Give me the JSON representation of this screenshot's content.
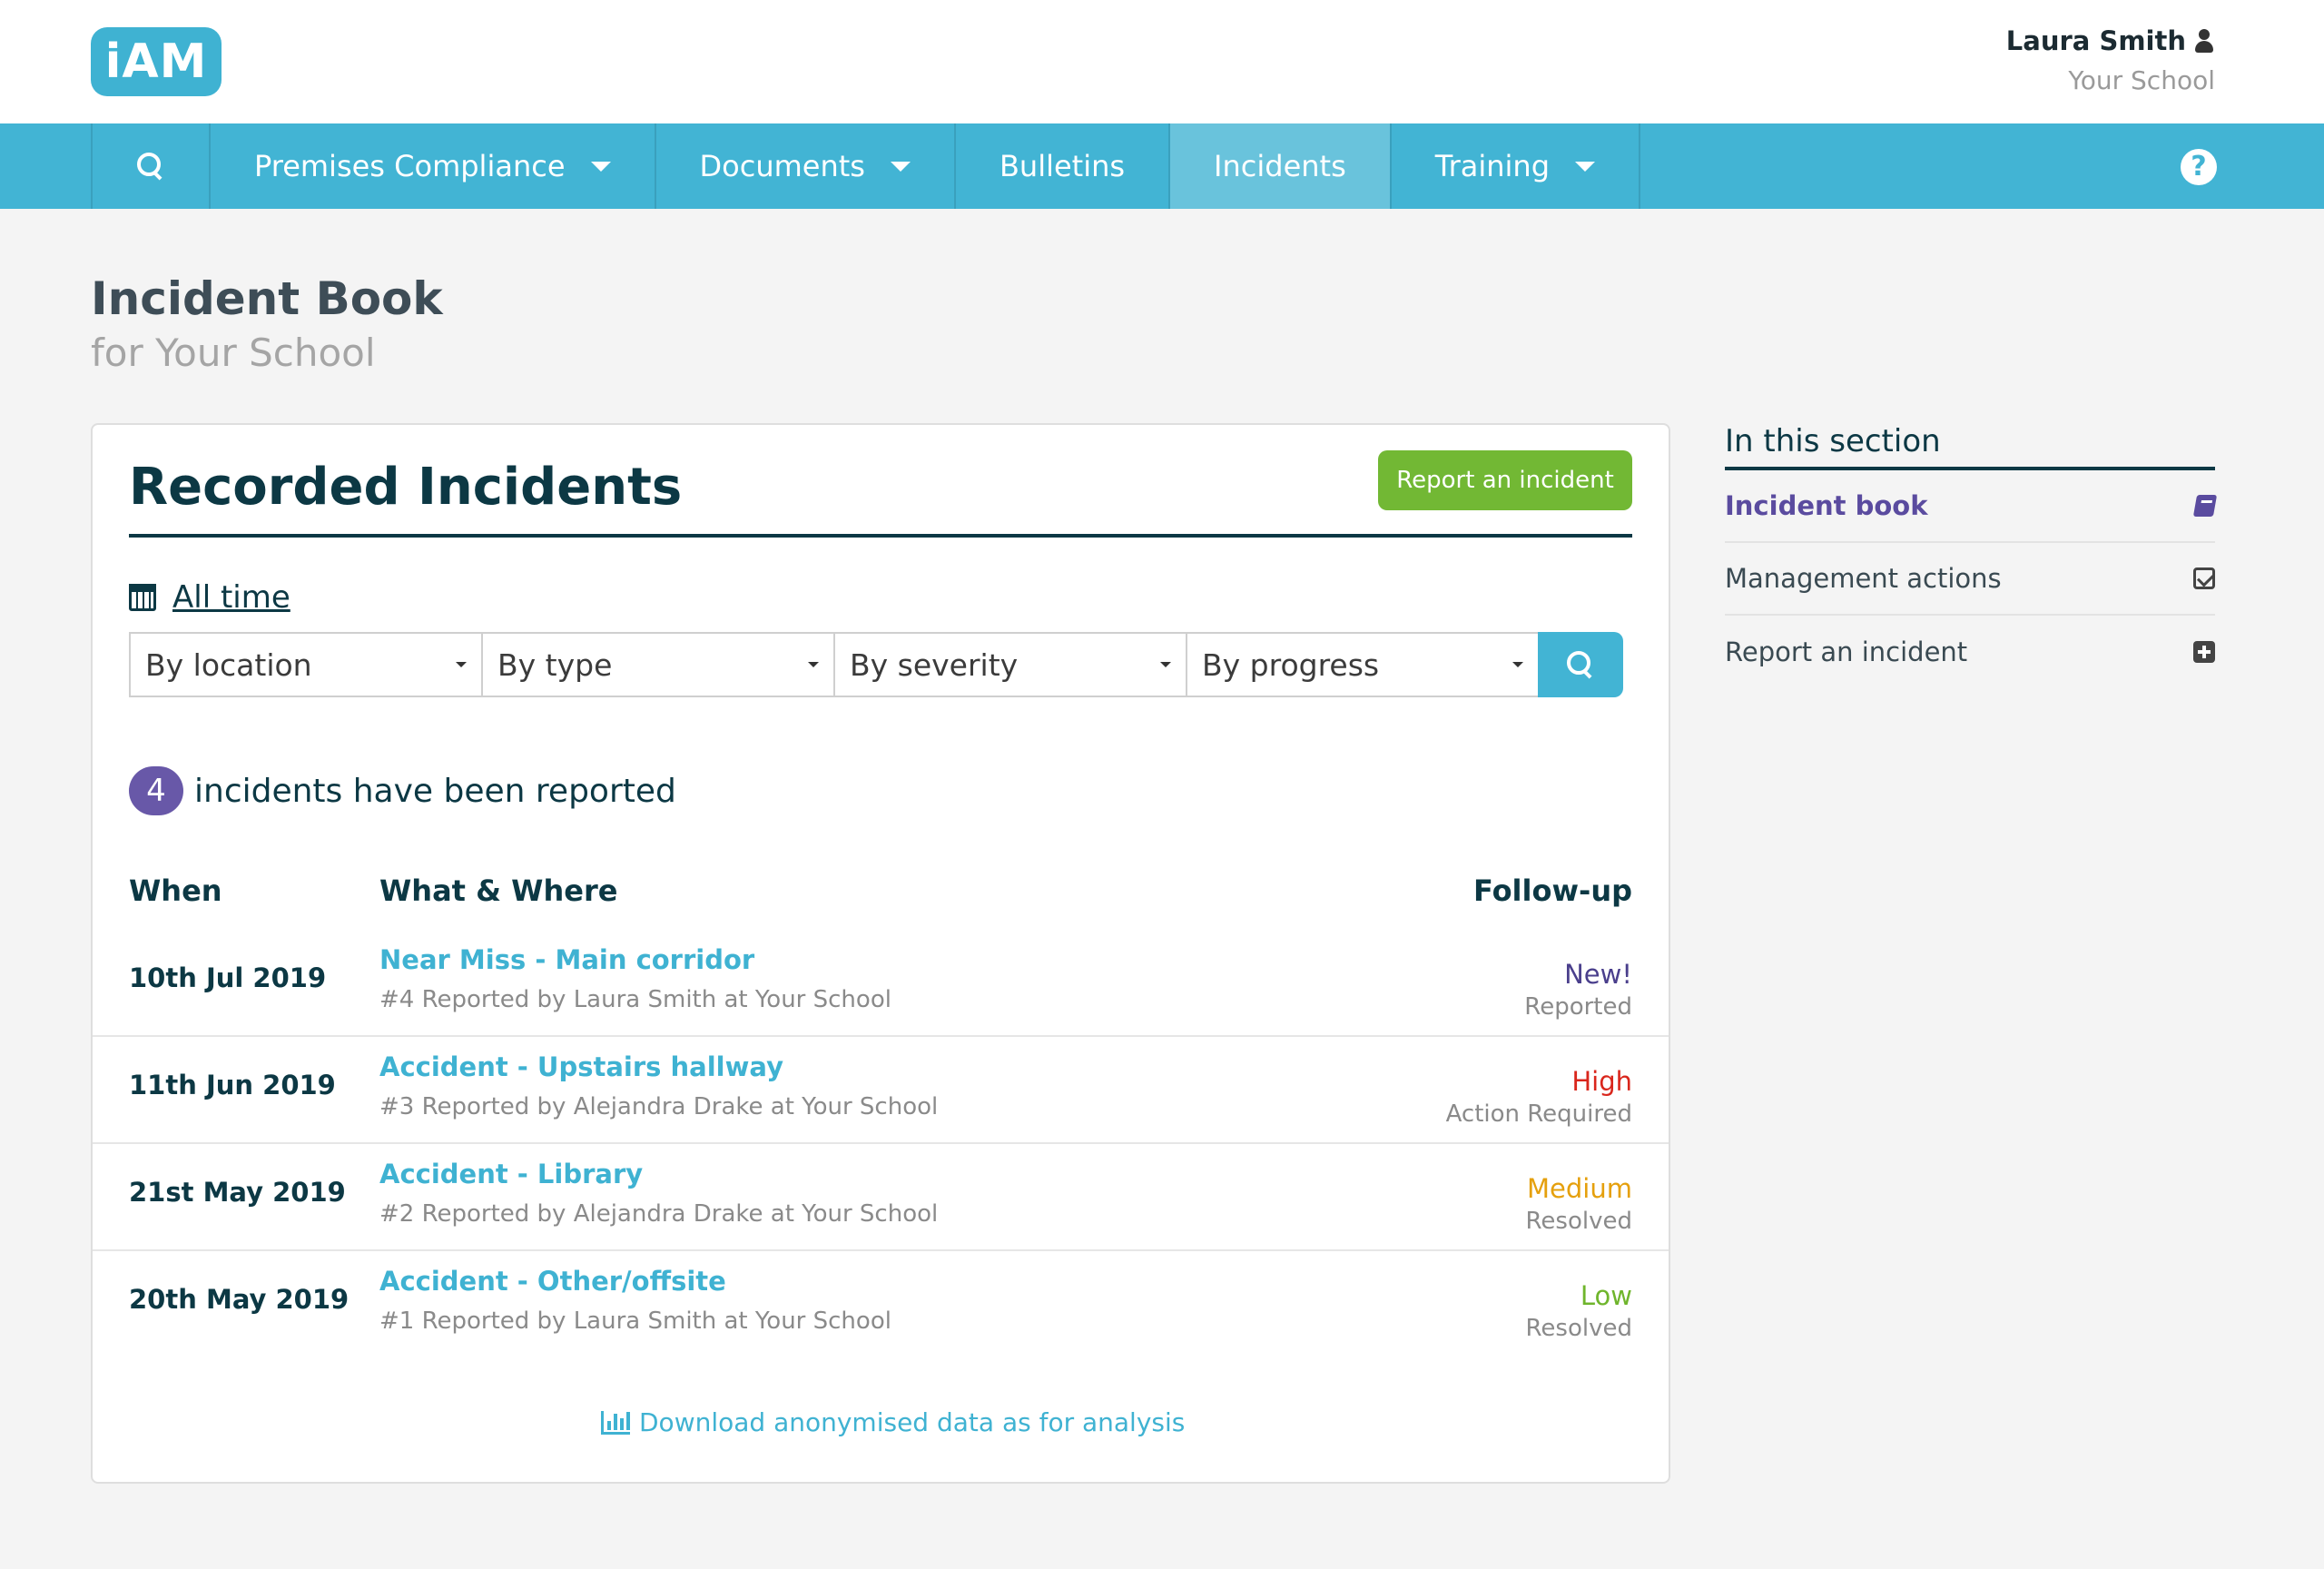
{
  "header": {
    "logo_text": "iAM",
    "user_name": "Laura Smith",
    "user_school": "Your School"
  },
  "nav": {
    "items": [
      {
        "label": "Premises Compliance"
      },
      {
        "label": "Documents"
      },
      {
        "label": "Bulletins"
      },
      {
        "label": "Incidents"
      },
      {
        "label": "Training"
      }
    ],
    "active": "Incidents",
    "help_glyph": "?"
  },
  "page": {
    "title": "Incident Book",
    "subtitle": "for Your School"
  },
  "card": {
    "title": "Recorded Incidents",
    "report_button": "Report an incident",
    "time_filter": "All time",
    "filters": {
      "location": "By location",
      "type": "By type",
      "severity": "By severity",
      "progress": "By progress"
    },
    "count": "4",
    "count_text": "incidents have been reported",
    "columns": {
      "when": "When",
      "what": "What & Where",
      "follow": "Follow-up"
    },
    "rows": [
      {
        "date": "10th Jul 2019",
        "title": "Near Miss - Main corridor",
        "sub": "#4 Reported by Laura Smith at Your School",
        "severity": "New!",
        "severity_color": "#4a3f8c",
        "status": "Reported"
      },
      {
        "date": "11th Jun 2019",
        "title": "Accident - Upstairs hallway",
        "sub": "#3 Reported by Alejandra Drake at Your School",
        "severity": "High",
        "severity_color": "#d9261c",
        "status": "Action Required"
      },
      {
        "date": "21st May 2019",
        "title": "Accident - Library",
        "sub": "#2 Reported by Alejandra Drake at Your School",
        "severity": "Medium",
        "severity_color": "#e5a00d",
        "status": "Resolved"
      },
      {
        "date": "20th May 2019",
        "title": "Accident - Other/offsite",
        "sub": "#1 Reported by Laura Smith at Your School",
        "severity": "Low",
        "severity_color": "#6fb52c",
        "status": "Resolved"
      }
    ],
    "download_link": "Download anonymised data as for analysis"
  },
  "sidebar": {
    "title": "In this section",
    "items": [
      {
        "label": "Incident book",
        "icon": "book-icon"
      },
      {
        "label": "Management actions",
        "icon": "check-square-icon"
      },
      {
        "label": "Report an incident",
        "icon": "plus-square-icon"
      }
    ]
  },
  "colors": {
    "brand": "#42b4d4",
    "dark": "#0c3844",
    "green": "#72b834",
    "purple": "#6858a8"
  }
}
